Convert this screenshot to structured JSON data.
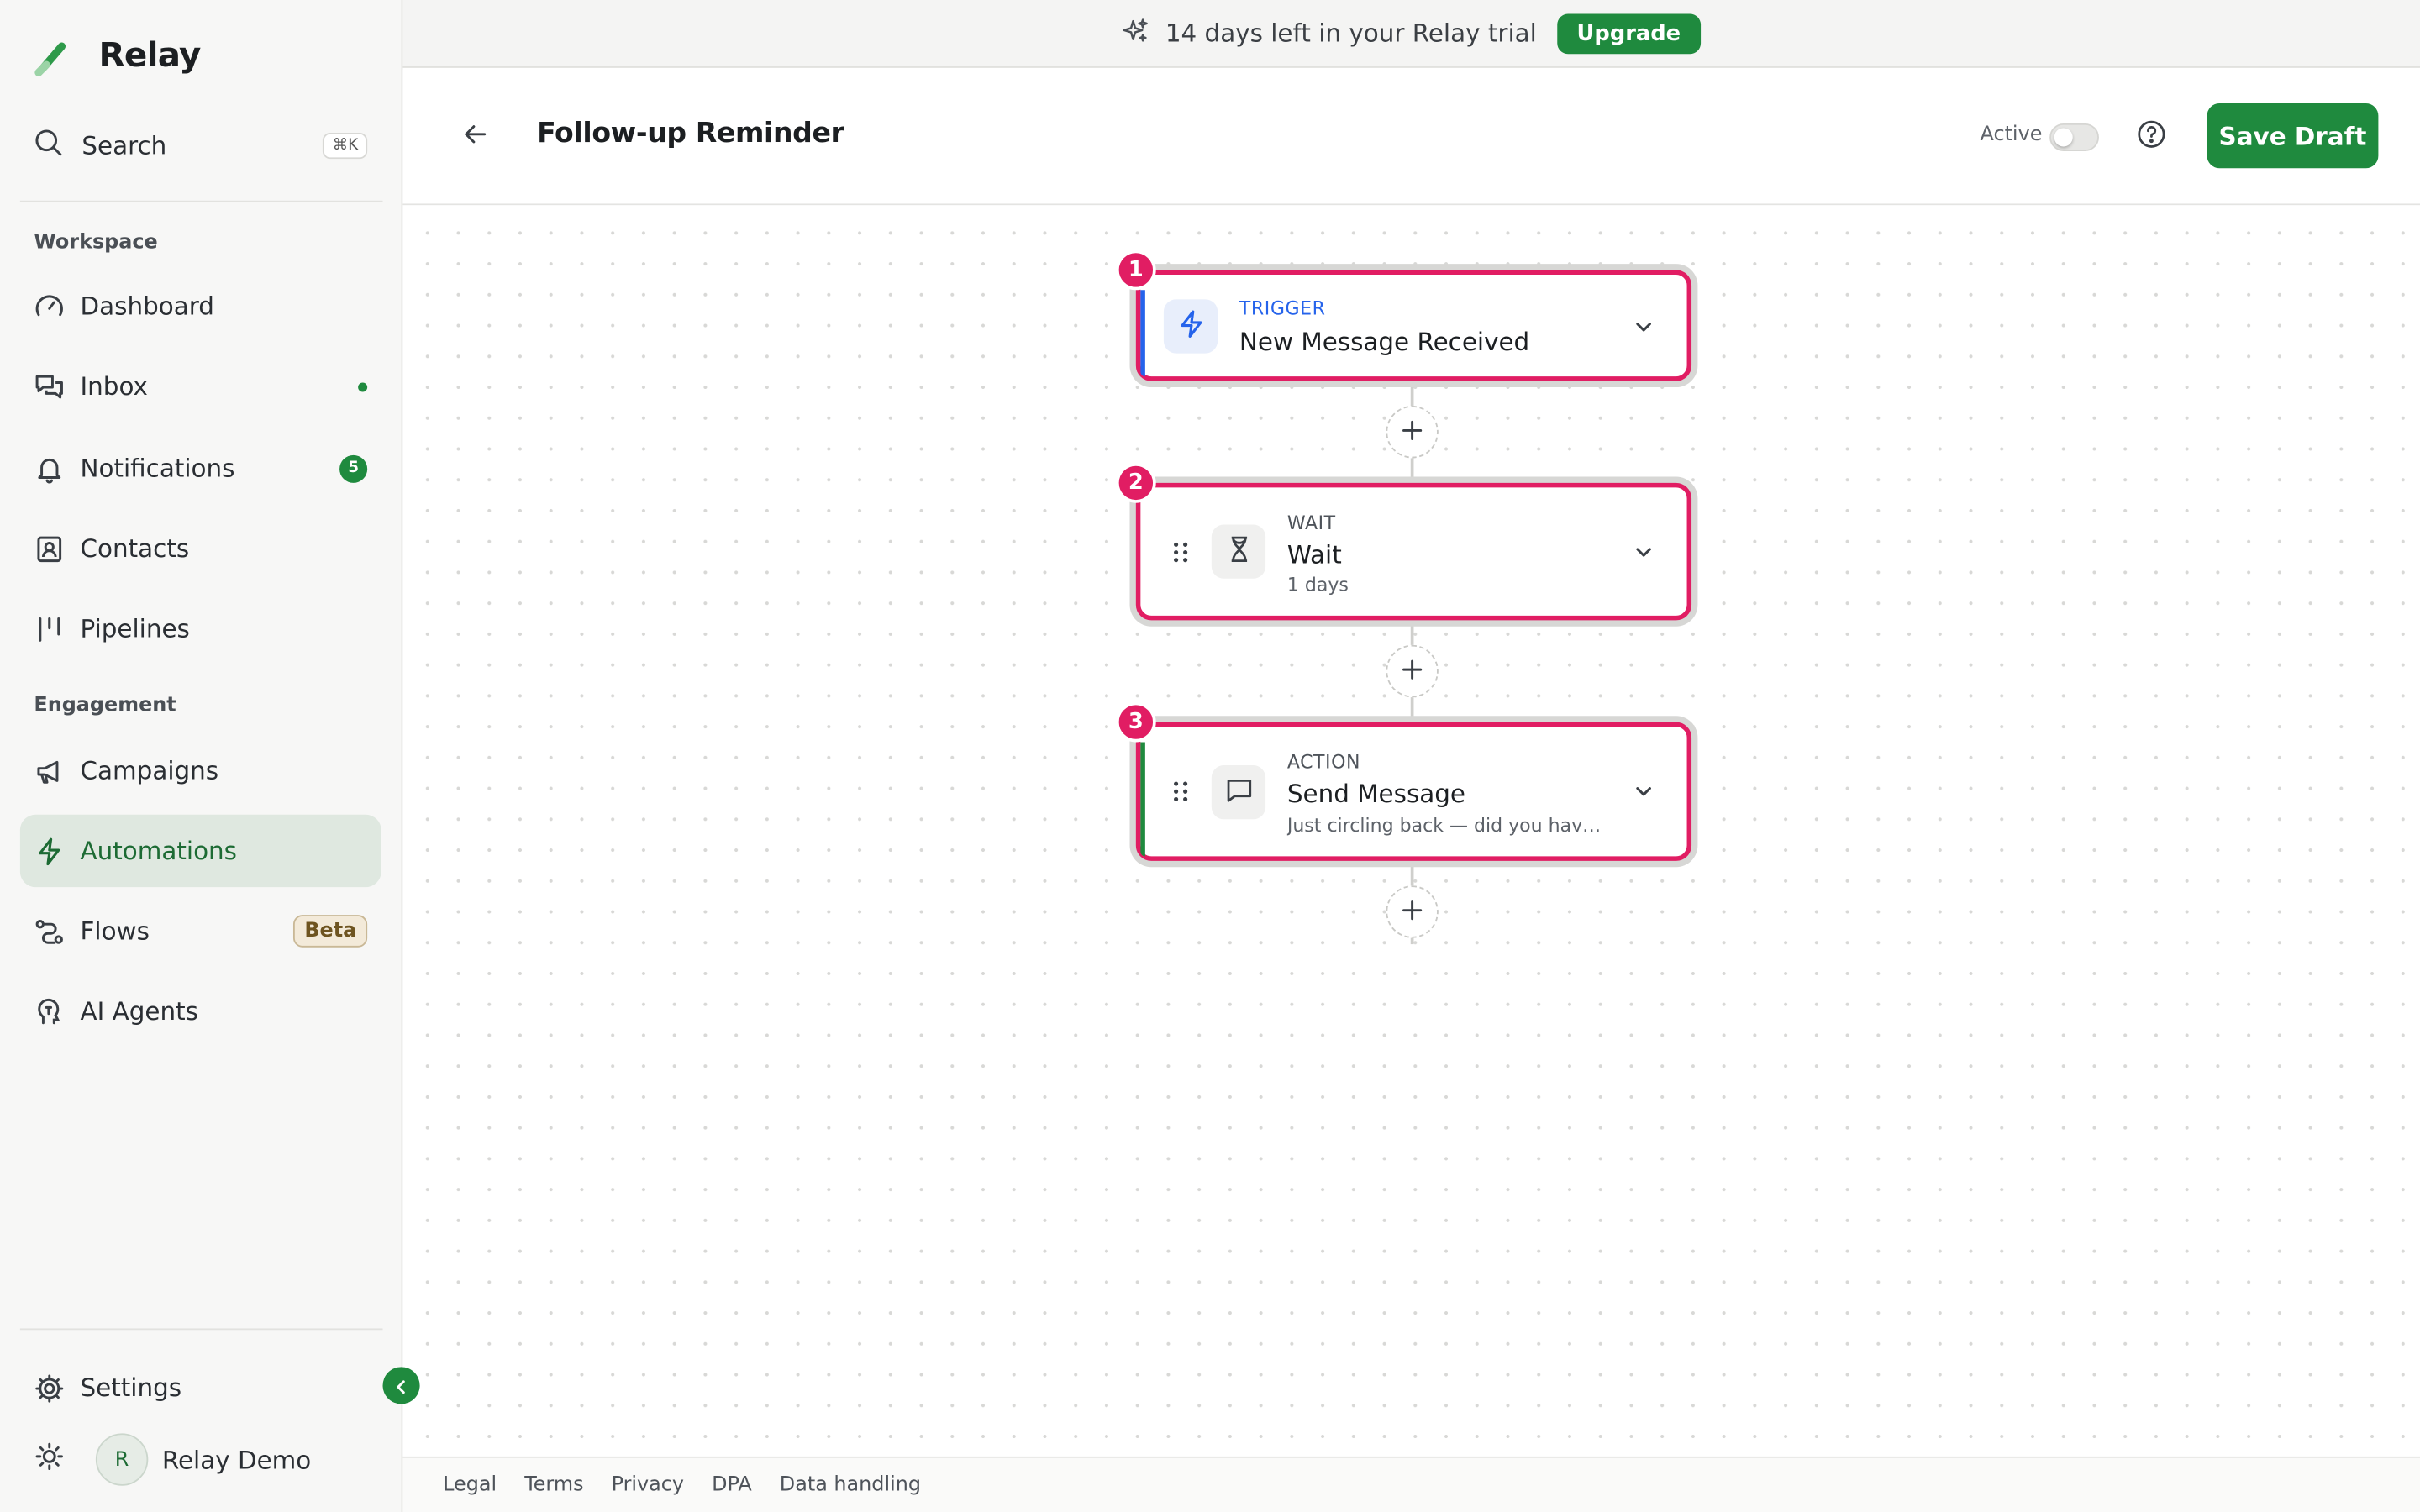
{
  "app": {
    "name": "Relay"
  },
  "search": {
    "label": "Search",
    "shortcut": "⌘K"
  },
  "sidebar": {
    "sections": {
      "workspace": "Workspace",
      "engagement": "Engagement"
    },
    "items": [
      {
        "label": "Dashboard",
        "icon": "gauge-icon"
      },
      {
        "label": "Inbox",
        "icon": "chat-bubbles-icon",
        "indicator": "dot"
      },
      {
        "label": "Notifications",
        "icon": "bell-icon",
        "count": "5"
      },
      {
        "label": "Contacts",
        "icon": "contact-card-icon"
      },
      {
        "label": "Pipelines",
        "icon": "kanban-icon"
      },
      {
        "label": "Campaigns",
        "icon": "megaphone-icon"
      },
      {
        "label": "Automations",
        "icon": "lightning-icon",
        "active": true
      },
      {
        "label": "Flows",
        "icon": "flow-icon",
        "badge": "Beta"
      },
      {
        "label": "AI Agents",
        "icon": "brain-icon"
      }
    ],
    "settings": "Settings",
    "user": {
      "initial": "R",
      "name": "Relay Demo"
    }
  },
  "banner": {
    "message": "14 days left in your Relay trial",
    "cta": "Upgrade"
  },
  "header": {
    "title": "Follow-up Reminder",
    "active_label": "Active",
    "active_on": false,
    "save_label": "Save Draft"
  },
  "workflow": {
    "steps": [
      {
        "number": "1",
        "type": "TRIGGER",
        "title": "New Message Received",
        "subtitle": ""
      },
      {
        "number": "2",
        "type": "WAIT",
        "title": "Wait",
        "subtitle": "1 days"
      },
      {
        "number": "3",
        "type": "ACTION",
        "title": "Send Message",
        "subtitle": "Just circling back — did you have an..."
      }
    ]
  },
  "footer": {
    "links": [
      "Legal",
      "Terms",
      "Privacy",
      "DPA",
      "Data handling"
    ]
  },
  "colors": {
    "brand_green": "#1f8a3e",
    "step_highlight": "#e11d63",
    "trigger_blue": "#2563eb"
  }
}
